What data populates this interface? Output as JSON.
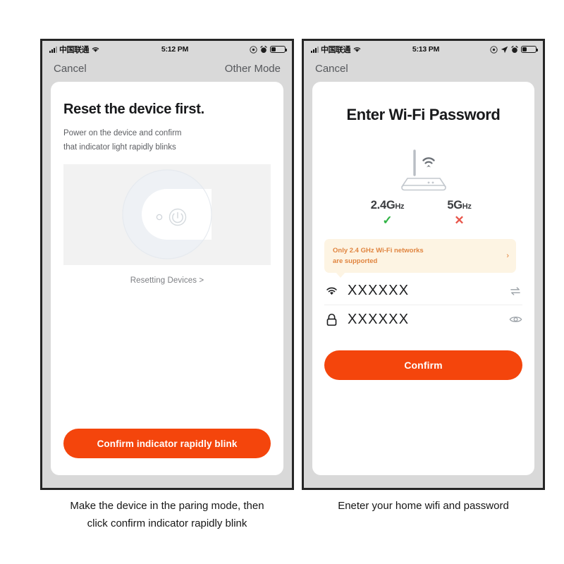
{
  "phones": [
    {
      "id": "left",
      "statusbar": {
        "carrier": "中国联通",
        "time": "5:12 PM",
        "icons": [
          "signal-bars-icon",
          "wifi-icon",
          "screen-lock-rotation-icon",
          "alarm-clock-icon",
          "battery-icon"
        ]
      },
      "navbar": {
        "cancel": "Cancel",
        "other_mode": "Other Mode"
      },
      "screen": {
        "title": "Reset the device first.",
        "subtitle_line1": "Power on the device and confirm",
        "subtitle_line2": "that indicator light rapidly blinks",
        "device_image_alt": "round-smart-device-illustration",
        "reset_link": "Resetting Devices >",
        "primary_button": "Confirm indicator rapidly blink"
      },
      "caption_line1": "Make the device in the paring mode, then",
      "caption_line2": "click confirm indicator rapidly blink"
    },
    {
      "id": "right",
      "statusbar": {
        "carrier": "中国联通",
        "time": "5:13 PM",
        "icons": [
          "signal-bars-icon",
          "wifi-icon",
          "screen-lock-rotation-icon",
          "location-arrow-icon",
          "alarm-clock-icon",
          "battery-icon"
        ]
      },
      "navbar": {
        "cancel": "Cancel",
        "other_mode": ""
      },
      "screen": {
        "title": "Enter Wi-Fi Password",
        "router_image_alt": "wifi-router-illustration",
        "frequencies": [
          {
            "label": "2.4G",
            "unit": "Hz",
            "mark": "✓",
            "supported": true
          },
          {
            "label": "5G",
            "unit": "Hz",
            "mark": "✕",
            "supported": false
          }
        ],
        "tip_line1": "Only 2.4 GHz Wi-Fi networks",
        "tip_line2": "are supported",
        "tip_chevron": "›",
        "ssid_value": "XXXXXX",
        "password_value": "XXXXXX",
        "primary_button": "Confirm"
      },
      "caption_line1": "Eneter your home wifi and password",
      "caption_line2": ""
    }
  ],
  "colors": {
    "accent_orange": "#f4450c",
    "tip_background": "#fdf4e3",
    "tip_text": "#e0843f",
    "check_green": "#2fb344",
    "cross_red": "#e8564b",
    "phone_background": "#d9d9d9",
    "card_background": "#ffffff"
  }
}
